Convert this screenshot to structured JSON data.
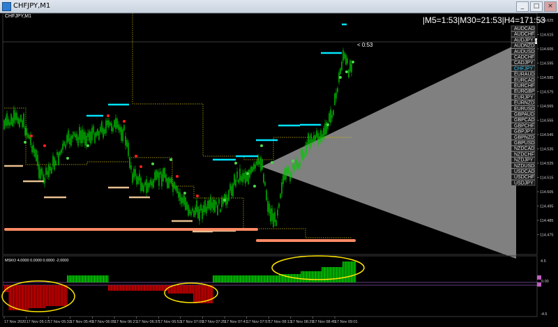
{
  "window": {
    "title": "CHFJPY,M1"
  },
  "chart": {
    "symbol_label": "CHFJPY,M1",
    "timeframe_info": "|M5=1:53|M30=21:53|H4=171:53",
    "countdown": "< 0:53",
    "current_price": "114.611",
    "price_ticks": [
      "114.625",
      "114.615",
      "114.605",
      "114.595",
      "114.585",
      "114.575",
      "114.565",
      "114.555",
      "114.545",
      "114.535",
      "114.525",
      "114.515",
      "114.505",
      "114.495",
      "114.485",
      "114.475"
    ]
  },
  "symbols": {
    "selected": "CHFJPY",
    "items": [
      "AUDCAD",
      "AUDCHF",
      "AUDJPY",
      "AUDNZD",
      "AUDUSD",
      "CADCHF",
      "CADJPY",
      "CHFJPY",
      "EURAUD",
      "EURCAD",
      "EURCHF",
      "EURGBP",
      "EURJPY",
      "EURNZD",
      "EURUSD",
      "GBPAUD",
      "GBPCAD",
      "GBPCHF",
      "GBPJPY",
      "GBPNZD",
      "GBPUSD",
      "NZDCAD",
      "NZDCHF",
      "NZDJPY",
      "NZDUSD",
      "USDCAD",
      "USDCHF",
      "USDJPY"
    ]
  },
  "indicator": {
    "label": "MSKO 4.0000 0.0000 0.0000 -2.0000",
    "scale_top": "4.5",
    "scale_mid": "0.00",
    "scale_bottom": "-4.5"
  },
  "time_axis": [
    "17 Nov 2020",
    "17 Nov 05:17",
    "17 Nov 05:33",
    "17 Nov 05:49",
    "17 Nov 06:05",
    "17 Nov 06:21",
    "17 Nov 06:37",
    "17 Nov 06:53",
    "17 Nov 07:09",
    "17 Nov 07:25",
    "17 Nov 07:41",
    "17 Nov 07:57",
    "17 Nov 08:13",
    "17 Nov 08:29",
    "17 Nov 08:45",
    "17 Nov 09:01"
  ],
  "colors": {
    "bull": "#00c800",
    "bear": "#d00000",
    "cyan": "#00e5ff",
    "salmon": "#ff8a65",
    "tan": "#e8c090",
    "highlight": "#ffe600",
    "wedge": "#808080"
  }
}
